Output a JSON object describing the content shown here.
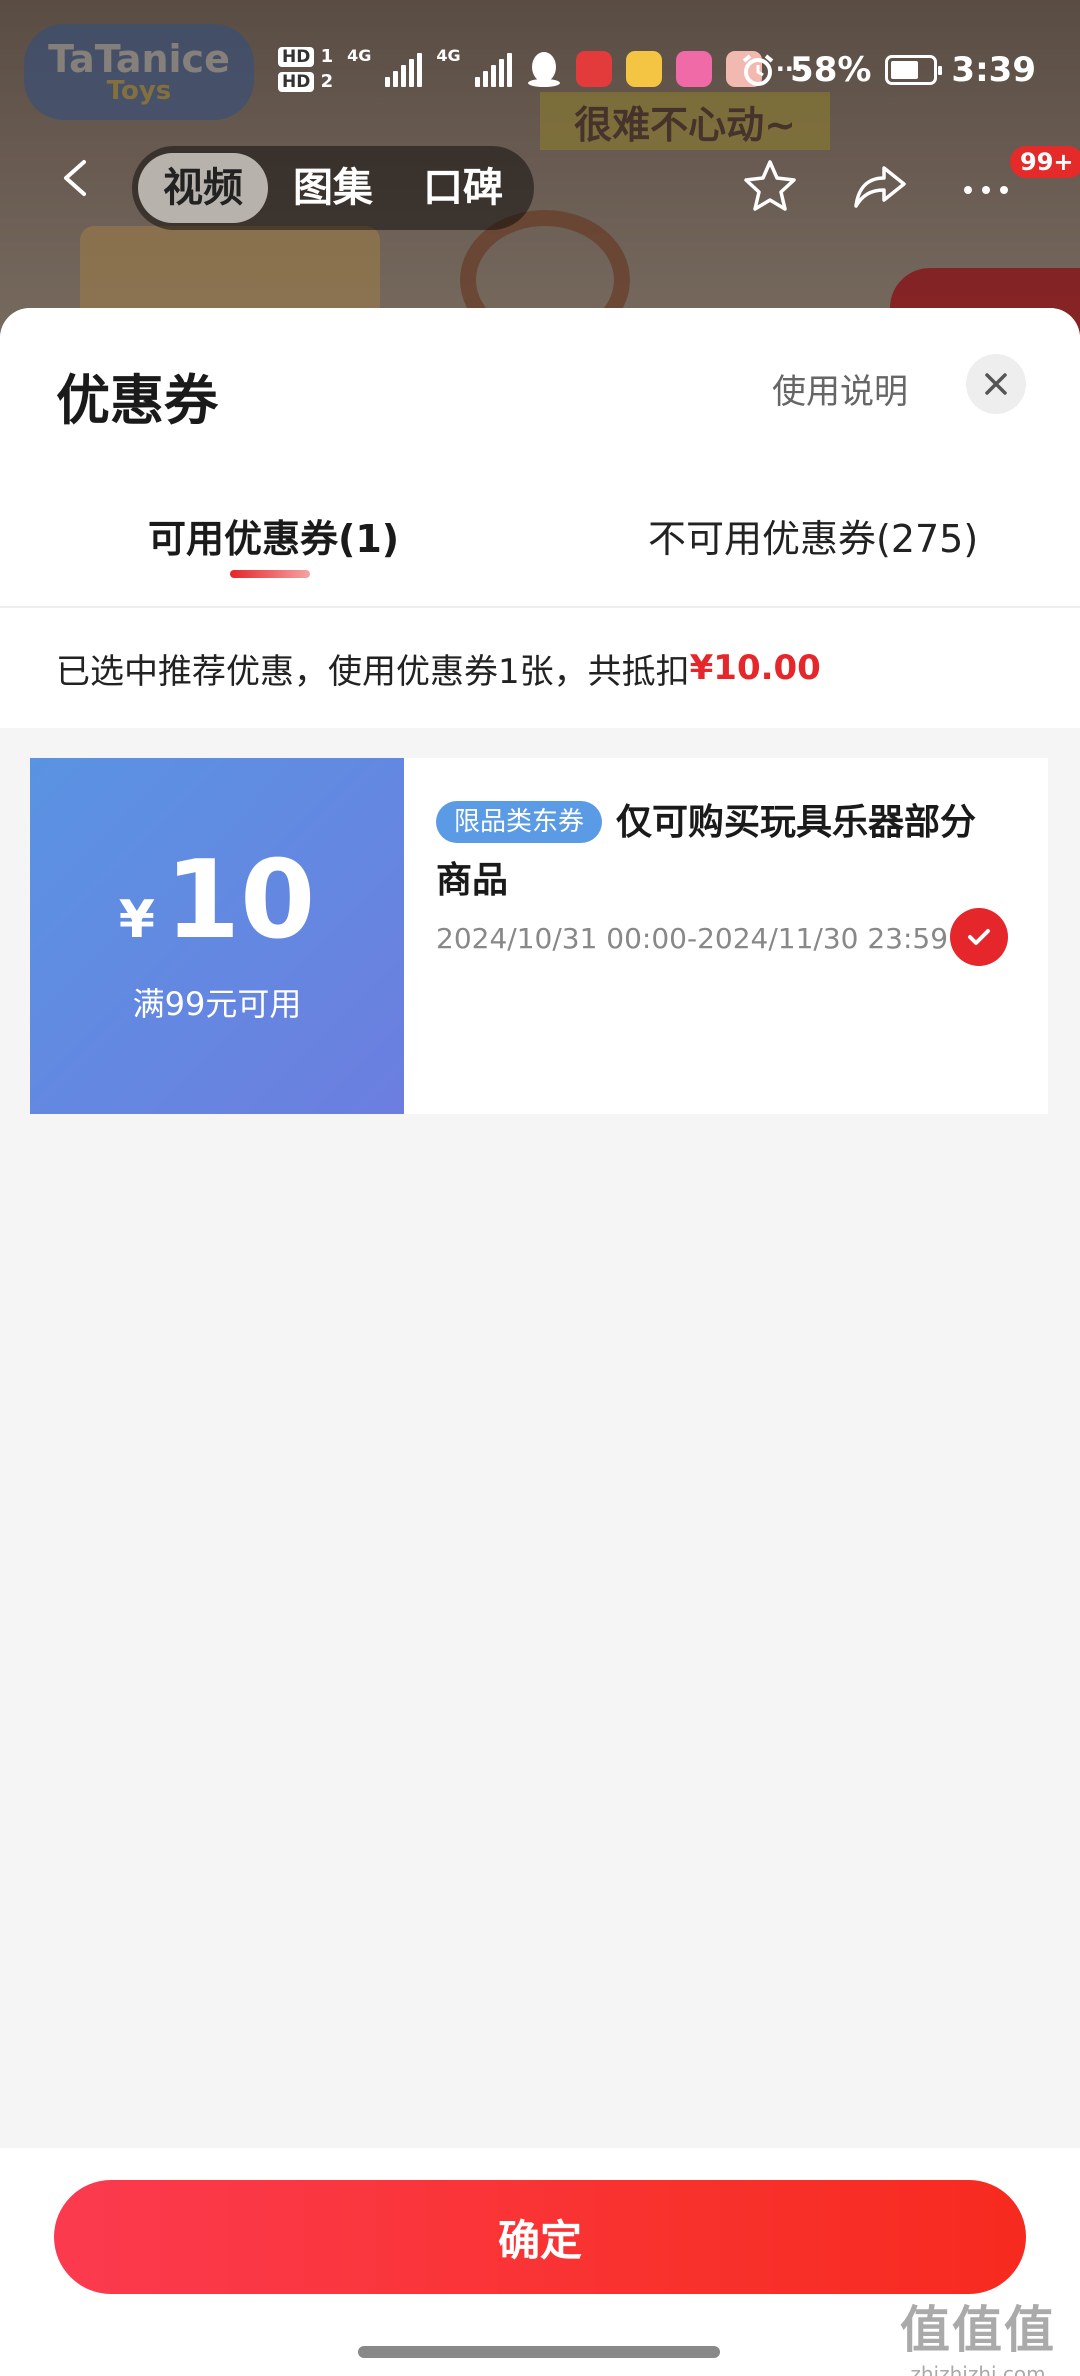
{
  "status_bar": {
    "hd1": "HD",
    "hd1_index": "1",
    "hd2": "HD",
    "hd2_index": "2",
    "net1": "4G",
    "net2": "4G",
    "more": "···",
    "battery": "58%",
    "time": "3:39"
  },
  "background": {
    "logo_line1": "TaTanice",
    "logo_line2": "Toys",
    "banner": "很难不心动~"
  },
  "product_nav": {
    "tabs": [
      "视频",
      "图集",
      "口碑"
    ],
    "active_tab": "视频",
    "badge": "99+"
  },
  "sheet": {
    "title": "优惠券",
    "usage_link": "使用说明",
    "tabs": [
      "可用优惠券(1)",
      "不可用优惠券(275)"
    ],
    "notice_text": "已选中推荐优惠，使用优惠券1张，共抵扣",
    "notice_amount": "¥10.00"
  },
  "coupon": {
    "currency": "¥",
    "amount": "10",
    "condition": "满99元可用",
    "tag": "限品类东券",
    "title": "仅可购买玩具乐器部分商品",
    "validity": "2024/10/31 00:00-2024/11/30 23:59",
    "selected": true,
    "colors": {
      "left_start": "#5a93e2",
      "left_end": "#6c7ee0",
      "tag": "#5b9be6",
      "check": "#e5262b"
    }
  },
  "footer": {
    "confirm_label": "确定",
    "accent": "#f9322f"
  },
  "watermark": {
    "big": "值值值",
    "small": "zhizhizhi.com"
  }
}
